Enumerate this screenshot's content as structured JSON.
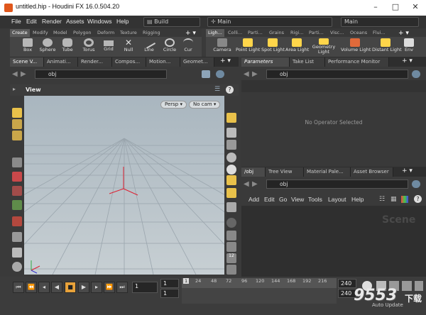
{
  "window": {
    "title": "untitled.hip - Houdini FX 16.0.504.20",
    "min": "–",
    "max": "□",
    "close": "✕"
  },
  "menu": [
    "File",
    "Edit",
    "Render",
    "Assets",
    "Windows",
    "Help"
  ],
  "desktop": {
    "build": "Build",
    "main": "Main",
    "main2": "Main"
  },
  "shelf_tabs_left": [
    "Create",
    "Modify",
    "Model",
    "Polygon",
    "Deform",
    "Texture",
    "Rigging"
  ],
  "shelf_tabs_right": [
    "Ligh...",
    "Colli...",
    "Parti...",
    "Grains",
    "Rigi...",
    "Parti...",
    "Visc...",
    "Oceans",
    "Flui..."
  ],
  "tools_left": [
    "Box",
    "Sphere",
    "Tube",
    "Torus",
    "Grid",
    "Null",
    "Line",
    "Circle",
    "Cur"
  ],
  "tools_right": [
    "Camera",
    "Point Light",
    "Spot Light",
    "Area Light",
    "Geometry Light",
    "Volume Light",
    "Distant Light",
    "Env"
  ],
  "left_tabs": [
    "Scene V...",
    "Animati...",
    "Render...",
    "Compos...",
    "Motion...",
    "Geomet..."
  ],
  "right_tabs": [
    "Parameters",
    "Take List",
    "Performance Monitor"
  ],
  "net_tabs": [
    "/obj",
    "Tree View",
    "Material Pale...",
    "Asset Browser"
  ],
  "path": {
    "left": "obj",
    "right": "obj",
    "net": "obj"
  },
  "view": {
    "label": "View",
    "persp": "Persp",
    "cam": "No cam"
  },
  "no_operator": "No Operator Selected",
  "net_menu": [
    "Add",
    "Edit",
    "Go",
    "View",
    "Tools",
    "Layout",
    "Help"
  ],
  "scene_label": "Scene",
  "timeline": {
    "current_frame": "1",
    "start": "1",
    "start2": "1",
    "ruler": [
      "1",
      "24",
      "48",
      "72",
      "96",
      "120",
      "144",
      "168",
      "192",
      "216"
    ],
    "end": "240",
    "end2": "240",
    "auto_update": "Auto Update"
  },
  "watermark": "9553",
  "watermark_sub": "下载"
}
